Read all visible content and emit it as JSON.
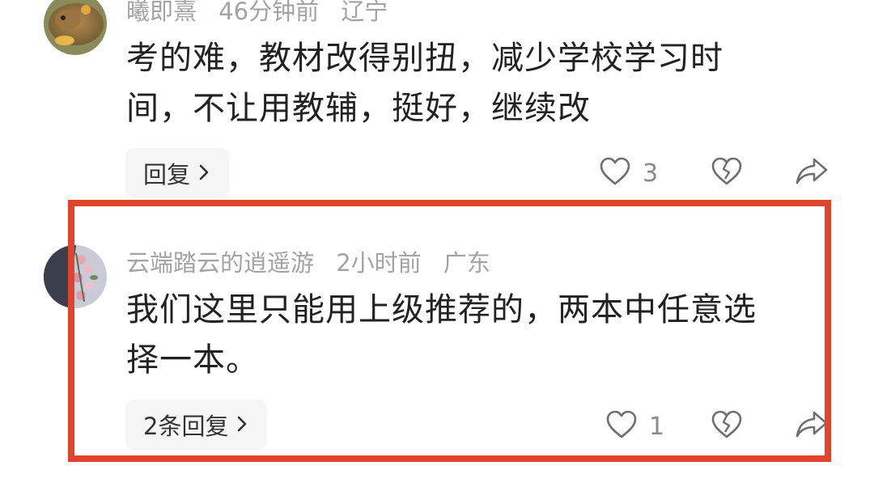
{
  "comments": [
    {
      "username": "曦即熹",
      "time": "46分钟前",
      "location": "辽宁",
      "lines": [
        "考的难，教材改得别扭，减少学校学习时",
        "间，不让用教辅，挺好，继续改"
      ],
      "reply_label": "回复",
      "like_count": "3"
    },
    {
      "username": "云端踏云的逍遥游",
      "time": "2小时前",
      "location": "广东",
      "lines": [
        "我们这里只能用上级推荐的，两本中任意选",
        "择一本。"
      ],
      "reply_label": "2条回复",
      "like_count": "1"
    }
  ],
  "icons": {
    "like": "heart-outline-icon",
    "dislike": "broken-heart-icon",
    "share": "share-arrow-icon",
    "chevron": "chevron-right-icon"
  },
  "colors": {
    "highlight_border": "#e0452c",
    "meta_text": "#a3a3a3",
    "body_text": "#222222",
    "reply_bg": "#f5f5f5"
  }
}
